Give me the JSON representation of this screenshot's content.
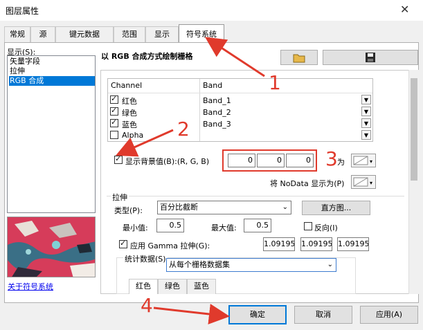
{
  "window": {
    "title": "图层属性",
    "close_glyph": "✕"
  },
  "tabs": [
    "常规",
    "源",
    "键元数据",
    "范围",
    "显示",
    "符号系统"
  ],
  "display": {
    "label": "显示(S):",
    "items": [
      "矢量字段",
      "拉伸",
      "RGB 合成"
    ],
    "about_link": "关于符号系统"
  },
  "header": {
    "title": "以 RGB 合成方式绘制栅格"
  },
  "band_table": {
    "headers": [
      "Channel",
      "Band"
    ],
    "rows": [
      {
        "channel": "红色",
        "band": "Band_1",
        "checked": true
      },
      {
        "channel": "绿色",
        "band": "Band_2",
        "checked": true
      },
      {
        "channel": "蓝色",
        "band": "Band_3",
        "checked": true
      },
      {
        "channel": "Alpha",
        "band": "",
        "checked": false
      }
    ]
  },
  "background": {
    "checkbox_label": "显示背景值(B):(R, G, B)",
    "checked": true,
    "values": [
      "0",
      "0",
      "0"
    ],
    "as_label": "为"
  },
  "nodata": {
    "label": "将 NoData 显示为(P)"
  },
  "stretch": {
    "group_label": "拉伸",
    "type_label": "类型(P):",
    "type_value": "百分比截断",
    "histogram_button": "直方图...",
    "min_label": "最小值:",
    "min_value": "0.5",
    "max_label": "最大值:",
    "max_value": "0.5",
    "invert_label": "反向(I)",
    "gamma_label": "应用 Gamma 拉伸(G):",
    "gamma_values": [
      "1.09195",
      "1.09195",
      "1.09195"
    ],
    "stats_label": "统计数据(S)",
    "stats_value": "从每个栅格数据集",
    "subtabs": [
      "红色",
      "绿色",
      "蓝色"
    ]
  },
  "buttons": {
    "ok": "确定",
    "cancel": "取消",
    "apply": "应用(A)"
  },
  "annotations": [
    "1",
    "2",
    "3",
    "4"
  ],
  "colors": {
    "selection": "#0078d7",
    "annotation": "#e03a2c",
    "link": "#0000ee"
  }
}
